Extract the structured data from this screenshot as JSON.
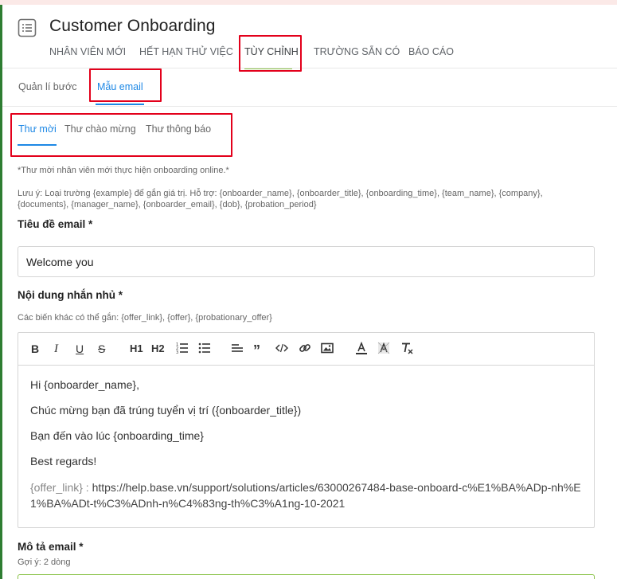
{
  "app": {
    "title": "Customer Onboarding"
  },
  "main_tabs": [
    {
      "label": "NHÂN VIÊN MỚI"
    },
    {
      "label": "HẾT HẠN THỬ VIỆC"
    },
    {
      "label": "TÙY CHỈNH"
    },
    {
      "label": "TRƯỜNG SẴN CÓ"
    },
    {
      "label": "BÁO CÁO"
    }
  ],
  "sub_tabs": [
    {
      "label": "Quản lí bước"
    },
    {
      "label": "Mẫu email"
    }
  ],
  "email_tabs": [
    {
      "label": "Thư mời"
    },
    {
      "label": "Thư chào mừng"
    },
    {
      "label": "Thư thông báo"
    }
  ],
  "notes": {
    "description": "*Thư mời nhân viên mới thực hiện onboarding online.*",
    "hint_line1": "Lưu ý: Loại trường {example} để gắn giá trị. Hỗ trợ: {onboarder_name}, {onboarder_title}, {onboarding_time}, {team_name}, {company},",
    "hint_line2": "{documents}, {manager_name}, {onboarder_email}, {dob}, {probation_period}"
  },
  "subject": {
    "label": "Tiêu đề email *",
    "value": "Welcome you"
  },
  "content": {
    "label": "Nội dung nhắn nhủ *",
    "hint": "Các biến khác có thể gắn: {offer_link}, {offer}, {probationary_offer}",
    "lines": [
      "Hi {onboarder_name},",
      "Chúc mừng bạn đã trúng tuyển vị trí ({onboarder_title})",
      "Bạn đến vào lúc {onboarding_time}",
      "Best regards!"
    ],
    "link_label": "{offer_link} :",
    "link_url": "https://help.base.vn/support/solutions/articles/63000267484-base-onboard-c%E1%BA%ADp-nh%E1%BA%ADt-t%C3%ADnh-n%C4%83ng-th%C3%A1ng-10-2021"
  },
  "toolbar": {
    "bold": "B",
    "italic": "I",
    "underline": "U",
    "strike": "S",
    "h1": "H1",
    "h2": "H2"
  },
  "description_field": {
    "label": "Mô tả email *",
    "hint": "Gợi ý: 2 dòng"
  },
  "colors": {
    "accent_blue": "#1e88e5",
    "accent_green": "#8bc34a",
    "annotation_red": "#e3001b"
  }
}
